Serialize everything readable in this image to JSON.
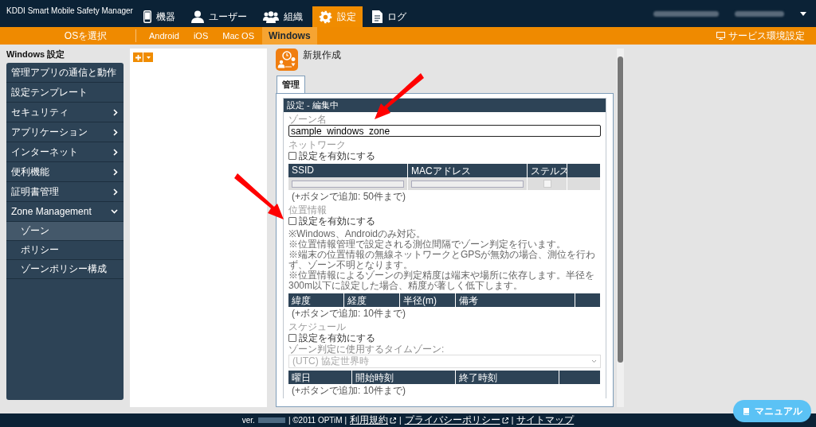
{
  "header": {
    "brand": "KDDI Smart Mobile Safety Manager",
    "nav": [
      {
        "kind": "phone",
        "label": "機器",
        "selected": false
      },
      {
        "kind": "person",
        "label": "ユーザー",
        "selected": false
      },
      {
        "kind": "group",
        "label": "組織",
        "selected": false
      },
      {
        "kind": "gear",
        "label": "設定",
        "selected": true
      },
      {
        "kind": "document",
        "label": "ログ",
        "selected": false
      }
    ]
  },
  "subnav": {
    "os_select": "OSを選択",
    "tabs": [
      {
        "label": "Android",
        "selected": false
      },
      {
        "label": "iOS",
        "selected": false
      },
      {
        "label": "Mac OS",
        "selected": false
      },
      {
        "label": "Windows",
        "selected": true
      }
    ],
    "service_link": "サービス環境設定"
  },
  "sidebar": {
    "title": "Windows 設定",
    "items": [
      {
        "label": "管理アプリの通信と動作",
        "kind": "link"
      },
      {
        "label": "設定テンプレート",
        "kind": "link"
      },
      {
        "label": "セキュリティ",
        "kind": "group",
        "expanded": false
      },
      {
        "label": "アプリケーション",
        "kind": "group",
        "expanded": false
      },
      {
        "label": "インターネット",
        "kind": "group",
        "expanded": false
      },
      {
        "label": "便利機能",
        "kind": "group",
        "expanded": false
      },
      {
        "label": "証明書管理",
        "kind": "group",
        "expanded": false
      },
      {
        "label": "Zone Management",
        "kind": "group",
        "expanded": true,
        "children": [
          {
            "label": "ゾーン",
            "selected": true
          },
          {
            "label": "ポリシー",
            "selected": false
          },
          {
            "label": "ゾーンポリシー構成",
            "selected": false
          }
        ]
      }
    ]
  },
  "content": {
    "title": "新規作成",
    "tabs": [
      {
        "label": "管理",
        "selected": true
      }
    ],
    "panel_title": "設定 - 編集中",
    "zone_name": {
      "label": "ゾーン名",
      "value": "sample_windows_zone"
    },
    "network": {
      "label": "ネットワーク",
      "checkbox": {
        "label": "設定を有効にする",
        "checked": false
      },
      "columns": [
        "SSID",
        "MACアドレス",
        "ステルス"
      ],
      "new_row": {
        "stealth_checked": false
      },
      "hint": "(+ボタンで追加: 50件まで)"
    },
    "location": {
      "label": "位置情報",
      "checkbox": {
        "label": "設定を有効にする",
        "checked": false
      },
      "notes": [
        "※Windows、Androidのみ対応。",
        "※位置情報管理で設定される測位間隔でゾーン判定を行います。",
        "※端末の位置情報の無線ネットワークとGPSが無効の場合、測位を行わず、ゾーン不明となります。",
        "※位置情報によるゾーンの判定精度は端末や場所に依存します。半径を300m以下に設定した場合、精度が著しく低下します。"
      ],
      "columns": [
        "緯度",
        "経度",
        "半径(m)",
        "備考"
      ],
      "hint": "(+ボタンで追加: 10件まで)"
    },
    "schedule": {
      "label": "スケジュール",
      "checkbox": {
        "label": "設定を有効にする",
        "checked": false
      },
      "timezone_label": "ゾーン判定に使用するタイムゾーン:",
      "timezone": "(UTC) 協定世界時",
      "columns": [
        "曜日",
        "開始時刻",
        "終了時刻"
      ],
      "hint": "(+ボタンで追加: 10件まで)"
    }
  },
  "footer": {
    "version": "ver.",
    "copyright": "| ©2011 OPTiM |",
    "links": [
      {
        "label": "利用規約",
        "external": true
      },
      {
        "label": "プライバシーポリシー",
        "external": true
      },
      {
        "label": "サイトマップ",
        "external": false
      }
    ],
    "separator": "|"
  },
  "manual_button": "マニュアル"
}
